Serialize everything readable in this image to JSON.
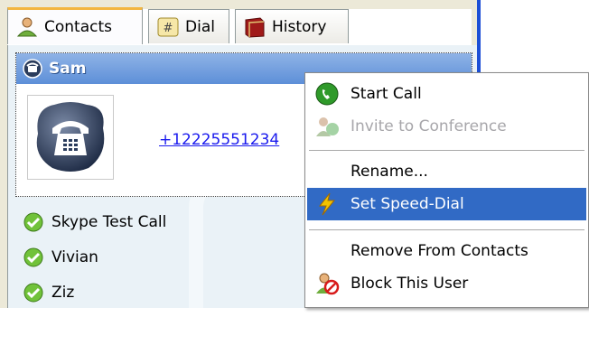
{
  "tabs": [
    {
      "label": "Contacts",
      "icon": "contacts-icon"
    },
    {
      "label": "Dial",
      "icon": "dialpad-icon"
    },
    {
      "label": "History",
      "icon": "history-book-icon"
    }
  ],
  "selected_contact": {
    "name": "Sam",
    "phone": "+12225551234",
    "icon": "skypeout-phone-icon"
  },
  "contacts": [
    {
      "name": "Skype Test Call",
      "status_icon": "online-check-icon"
    },
    {
      "name": "Vivian",
      "status_icon": "online-check-icon"
    },
    {
      "name": "Ziz",
      "status_icon": "online-check-icon"
    }
  ],
  "context_menu": {
    "items": [
      {
        "label": "Start Call",
        "icon": "call-green-icon",
        "enabled": true
      },
      {
        "label": "Invite to Conference",
        "icon": "conference-icon",
        "enabled": false
      },
      {
        "label": "Rename...",
        "icon": "",
        "enabled": true
      },
      {
        "label": "Set Speed-Dial",
        "icon": "lightning-icon",
        "enabled": true,
        "selected": true
      },
      {
        "label": "Remove From Contacts",
        "icon": "",
        "enabled": true
      },
      {
        "label": "Block This User",
        "icon": "block-user-icon",
        "enabled": true
      }
    ]
  },
  "colors": {
    "menu_highlight": "#316ac5",
    "header_blue": "#5d8fd8",
    "link": "#1a1aee",
    "tab_accent": "#f3b640"
  }
}
